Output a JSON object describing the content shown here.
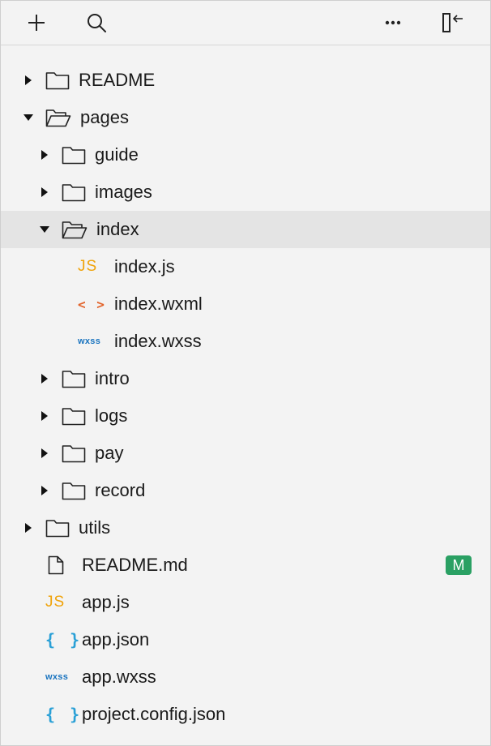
{
  "toolbar": {
    "add_icon": "plus-icon",
    "search_icon": "search-icon",
    "more_icon": "ellipsis-icon",
    "collapse_icon": "collapse-panel-icon"
  },
  "tree": {
    "readme_folder": "README",
    "pages_folder": "pages",
    "guide_folder": "guide",
    "images_folder": "images",
    "index_folder": "index",
    "index_js": "index.js",
    "index_wxml": "index.wxml",
    "index_wxss": "index.wxss",
    "intro_folder": "intro",
    "logs_folder": "logs",
    "pay_folder": "pay",
    "record_folder": "record",
    "utils_folder": "utils",
    "readme_md": "README.md",
    "readme_md_badge": "M",
    "app_js": "app.js",
    "app_json": "app.json",
    "app_wxss": "app.wxss",
    "project_config": "project.config.json"
  },
  "file_icons": {
    "js": "JS",
    "wxml": "< >",
    "wxss": "wxss",
    "json": "{ }"
  },
  "colors": {
    "js": "#f0a30a",
    "wxml": "#e2632a",
    "wxss": "#1a74bf",
    "json": "#2aa0d6",
    "modified_badge": "#2aa063",
    "selected_row": "#e4e4e4"
  }
}
